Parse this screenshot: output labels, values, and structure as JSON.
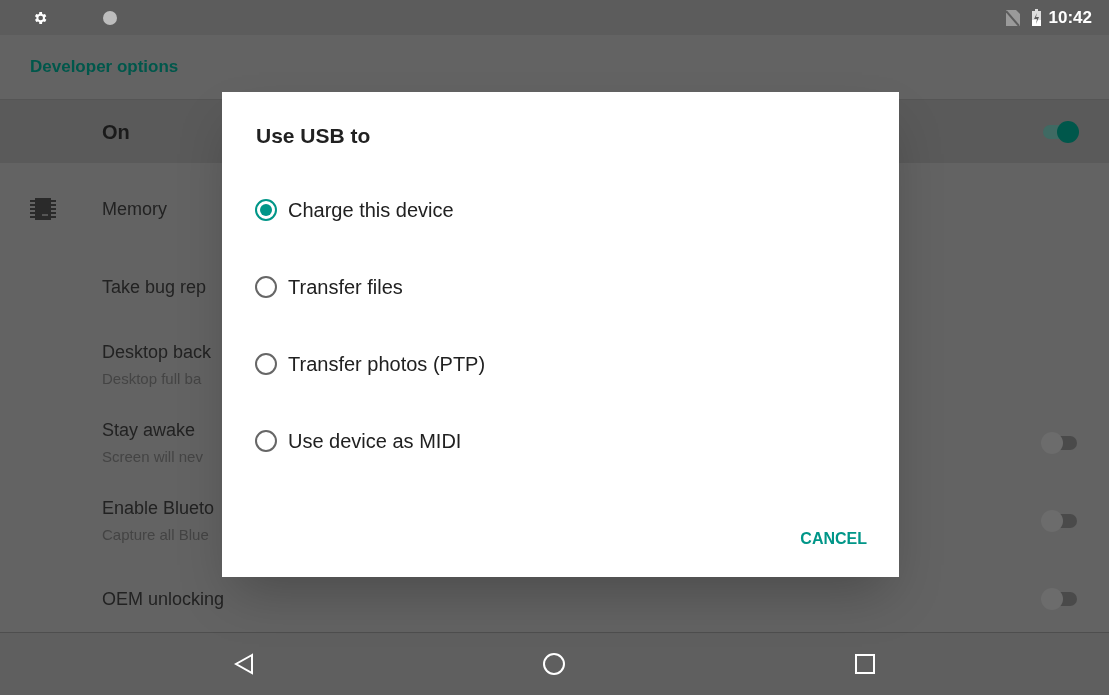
{
  "status_bar": {
    "time": "10:42"
  },
  "header": {
    "title": "Developer options"
  },
  "master": {
    "label": "On",
    "on": true
  },
  "settings": [
    {
      "kind": "icon",
      "title": "Memory"
    },
    {
      "kind": "plain",
      "title": "Take bug rep"
    },
    {
      "kind": "plain",
      "title": "Desktop back",
      "summary": "Desktop full ba"
    },
    {
      "kind": "toggle",
      "title": "Stay awake",
      "summary": "Screen will nev",
      "on": false
    },
    {
      "kind": "toggle",
      "title": "Enable Blueto",
      "summary": "Capture all Blue",
      "on": false
    },
    {
      "kind": "toggle",
      "title": "OEM unlocking",
      "on": false
    }
  ],
  "dialog": {
    "title": "Use USB to",
    "options": [
      {
        "label": "Charge this device",
        "selected": true
      },
      {
        "label": "Transfer files",
        "selected": false
      },
      {
        "label": "Transfer photos (PTP)",
        "selected": false
      },
      {
        "label": "Use device as MIDI",
        "selected": false
      }
    ],
    "button": "CANCEL"
  }
}
